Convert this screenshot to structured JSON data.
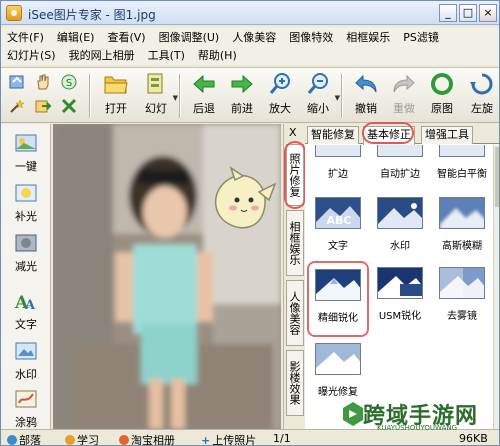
{
  "window": {
    "title": "iSee图片专家 - 图1.jpg",
    "controls": [
      "_",
      "□",
      "×"
    ]
  },
  "menu": {
    "row1": [
      "文件(F)",
      "编辑(E)",
      "查看(V)",
      "图像调整(U)",
      "人像美容",
      "图像特效",
      "相框娱乐",
      "PS滤镜"
    ],
    "row2": [
      "幻灯片(S)",
      "我的网上相册",
      "工具(T)",
      "帮助(H)"
    ]
  },
  "toolbar": {
    "open": "打开",
    "slideshow": "幻灯",
    "back": "后退",
    "forward": "前进",
    "zoom_in": "放大",
    "zoom_out": "缩小",
    "undo": "撤销",
    "redo": "重做",
    "original": "原图",
    "left_rotate": "左旋"
  },
  "left_tools": [
    "一键",
    "补光",
    "减光",
    "文字",
    "水印",
    "涂鸦"
  ],
  "vertical_tabs": {
    "close": "X",
    "tabs": [
      "照片修复",
      "相框娱乐",
      "人像美容",
      "影楼效果"
    ]
  },
  "effect_panel": {
    "tabs": [
      "智能修复",
      "基本修正",
      "增强工具"
    ],
    "active_tab": "基本修正",
    "items": [
      "扩边",
      "自动扩边",
      "智能白平衡",
      "文字",
      "水印",
      "高斯模糊",
      "精细锐化",
      "USM锐化",
      "去雾镜",
      "曝光修复"
    ],
    "thumb_text_abc": "ABC"
  },
  "statusbar": {
    "items": [
      "部落",
      "学习",
      "淘宝相册",
      "上传照片"
    ],
    "page": "1/1",
    "size": "96KB"
  },
  "watermark": {
    "text": "跨域手游网",
    "sub": "KUAYUSHOUYOUWANG"
  },
  "colors": {
    "highlight": "#e05a5a",
    "title_bg": "#dbe7f6",
    "toolbar_bg": "#ece9d8",
    "watermark": "#2c6d2c"
  }
}
